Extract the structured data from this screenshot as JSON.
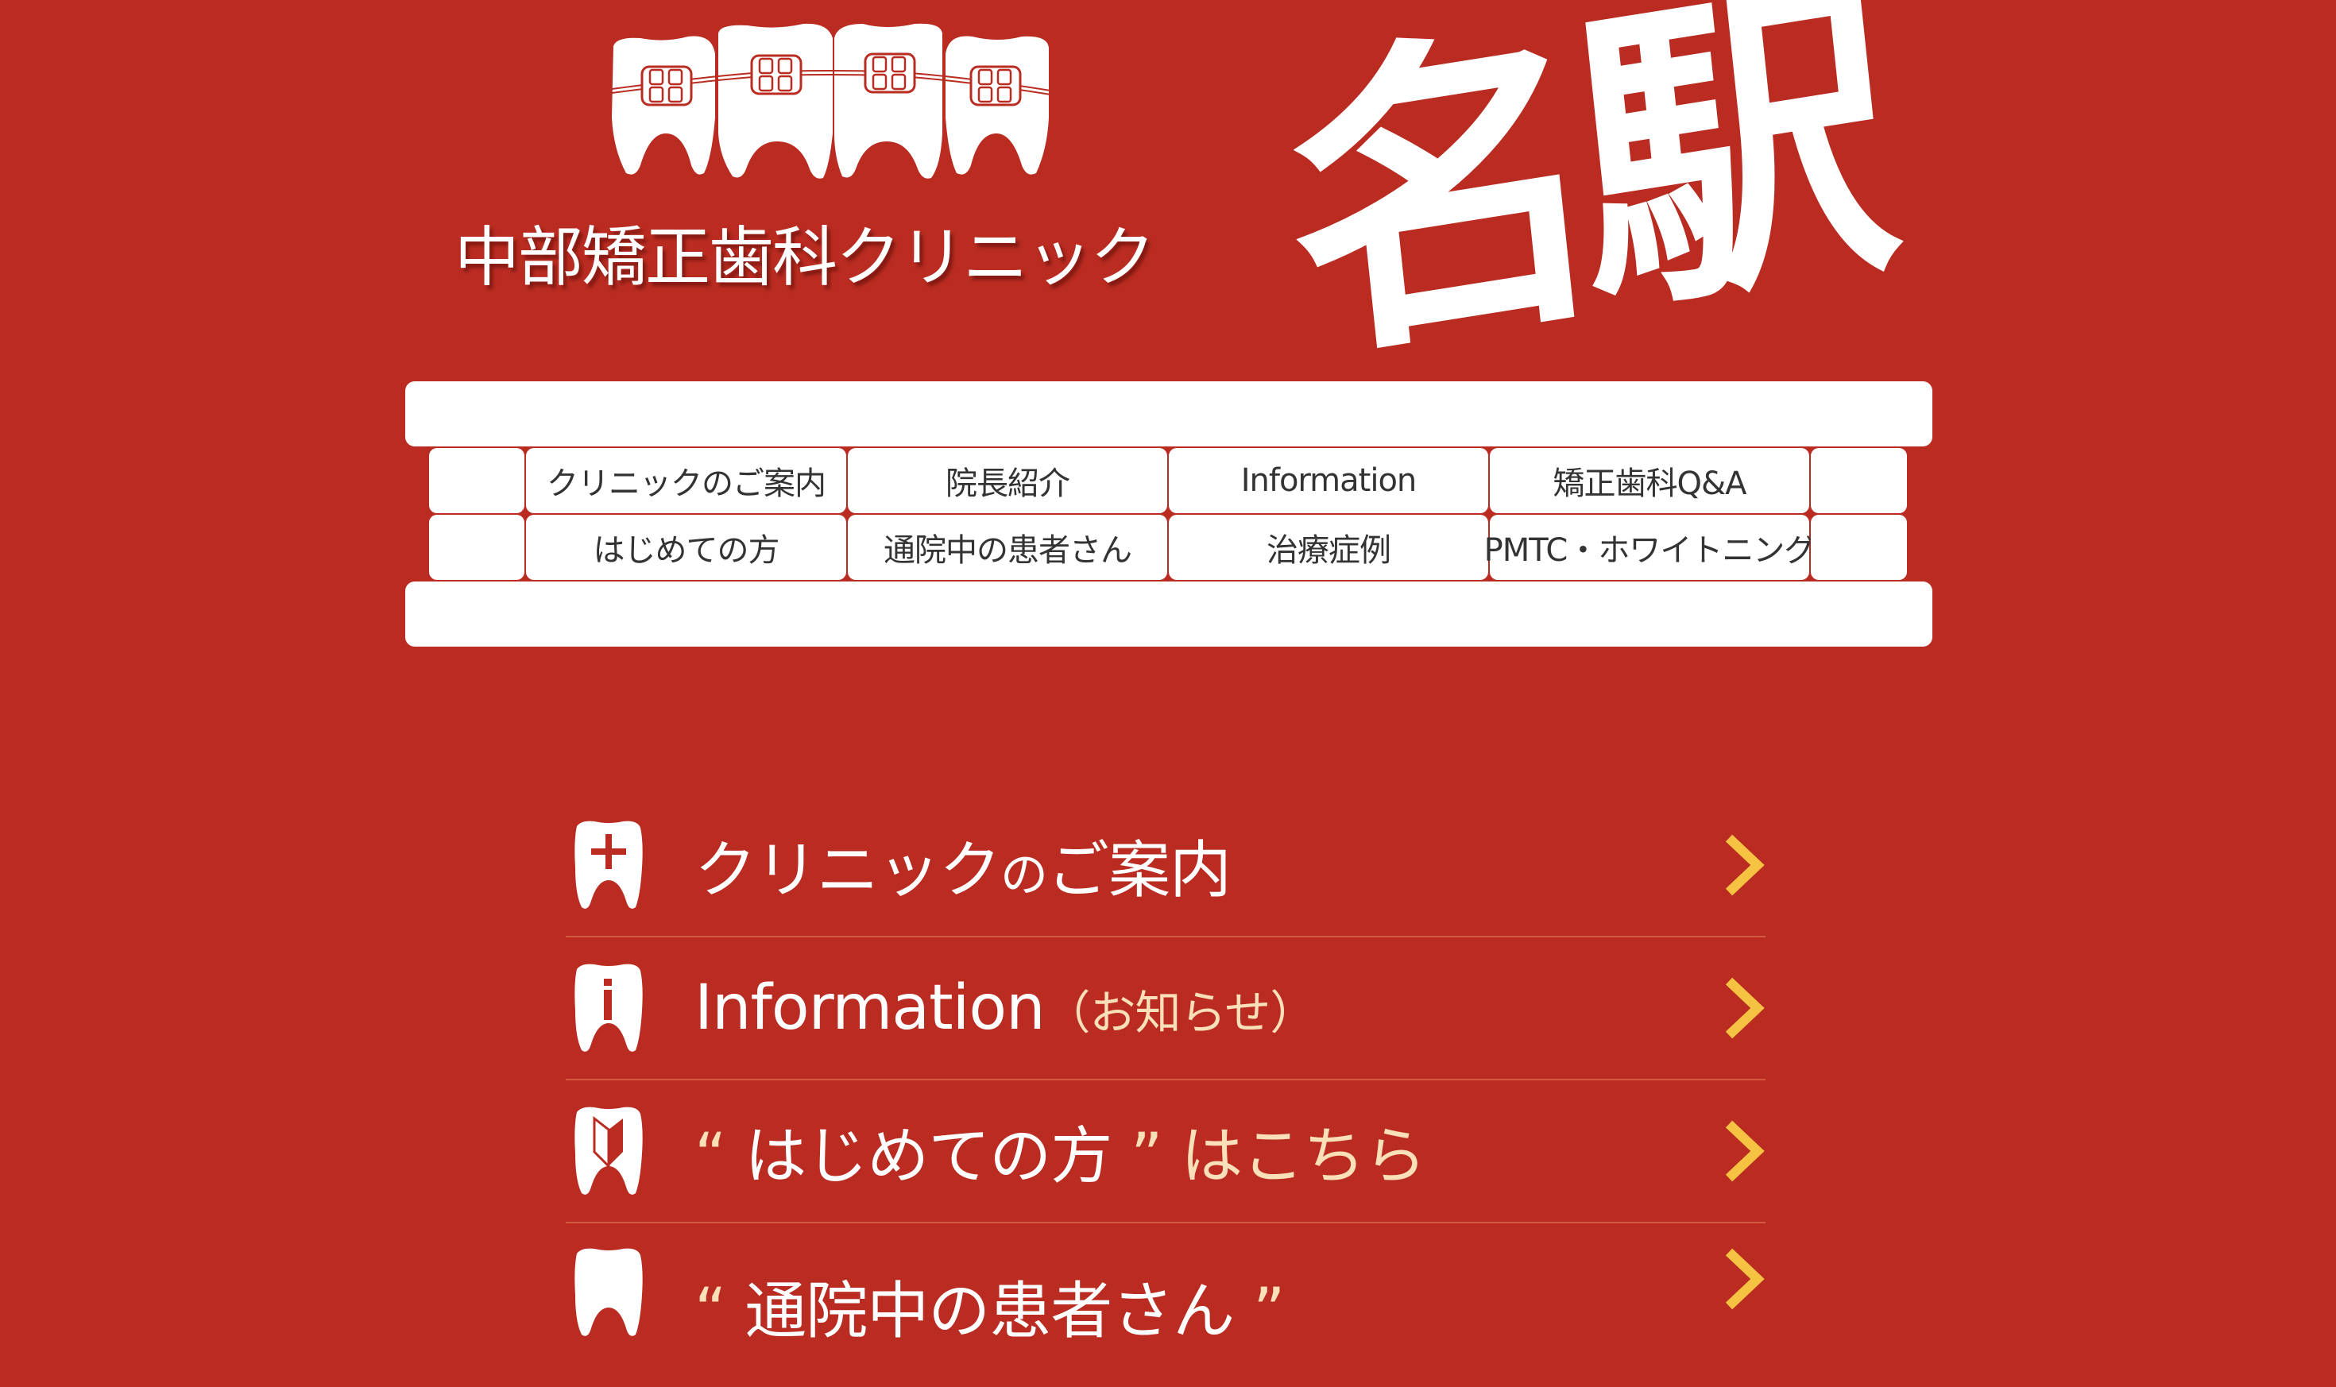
{
  "header": {
    "logo_icon": "teeth-with-braces",
    "clinic_name": "中部矯正歯科クリニック",
    "station_label": "名駅"
  },
  "nav": {
    "items": [
      {
        "label": "クリニックのご案内"
      },
      {
        "label": "院長紹介"
      },
      {
        "label": "Information"
      },
      {
        "label": "矯正歯科Q&A"
      },
      {
        "label": "はじめての方"
      },
      {
        "label": "通院中の患者さん"
      },
      {
        "label": "治療症例"
      },
      {
        "label": "PMTC・ホワイトニング"
      }
    ]
  },
  "menu": {
    "items": [
      {
        "icon": "tooth-cross-icon",
        "main": "クリニック",
        "small": "の",
        "main2": "ご案内",
        "sub": ""
      },
      {
        "icon": "tooth-info-icon",
        "main": "Information",
        "sub": "（お知らせ）"
      },
      {
        "icon": "tooth-beginner-mark-icon",
        "quote_open": "“",
        "main": "はじめての方",
        "quote_close": "”",
        "sub": "はこちら"
      },
      {
        "icon": "tooth-icon",
        "quote_open": "“",
        "main": "通院中の患者さん",
        "quote_close": "”",
        "sub": ""
      }
    ],
    "chevron_icon": "chevron-right-icon"
  },
  "colors": {
    "background": "#BA2C21",
    "accent_chevron": "#F5C242",
    "sub_text": "#FAE0B8",
    "divider": "#D4593E",
    "nav_text": "#333333"
  }
}
